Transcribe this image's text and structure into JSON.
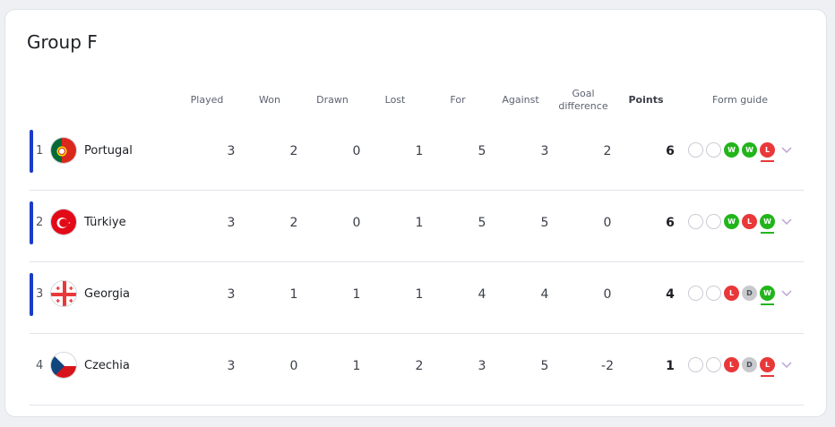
{
  "group_title": "Group F",
  "columns": {
    "played": "Played",
    "won": "Won",
    "drawn": "Drawn",
    "lost": "Lost",
    "for": "For",
    "against": "Against",
    "goal_difference": "Goal difference",
    "points": "Points",
    "form_guide": "Form guide"
  },
  "colors": {
    "qualifier": "#1a3cc7",
    "win": "#22b51b",
    "loss": "#e8383a",
    "draw": "#c8cace"
  },
  "rows": [
    {
      "pos": "1",
      "team": "Portugal",
      "flag": "portugal-flag-icon",
      "played": "3",
      "won": "2",
      "drawn": "0",
      "lost": "1",
      "for": "5",
      "against": "3",
      "gd": "2",
      "points": "6",
      "qualified": true,
      "form": [
        {
          "r": "E",
          "t": ""
        },
        {
          "r": "E",
          "t": ""
        },
        {
          "r": "W",
          "t": "W"
        },
        {
          "r": "W",
          "t": "W"
        },
        {
          "r": "L",
          "t": "L"
        }
      ]
    },
    {
      "pos": "2",
      "team": "Türkiye",
      "flag": "turkiye-flag-icon",
      "played": "3",
      "won": "2",
      "drawn": "0",
      "lost": "1",
      "for": "5",
      "against": "5",
      "gd": "0",
      "points": "6",
      "qualified": true,
      "form": [
        {
          "r": "E",
          "t": ""
        },
        {
          "r": "E",
          "t": ""
        },
        {
          "r": "W",
          "t": "W"
        },
        {
          "r": "L",
          "t": "L"
        },
        {
          "r": "W",
          "t": "W"
        }
      ]
    },
    {
      "pos": "3",
      "team": "Georgia",
      "flag": "georgia-flag-icon",
      "played": "3",
      "won": "1",
      "drawn": "1",
      "lost": "1",
      "for": "4",
      "against": "4",
      "gd": "0",
      "points": "4",
      "qualified": true,
      "form": [
        {
          "r": "E",
          "t": ""
        },
        {
          "r": "E",
          "t": ""
        },
        {
          "r": "L",
          "t": "L"
        },
        {
          "r": "D",
          "t": "D"
        },
        {
          "r": "W",
          "t": "W"
        }
      ]
    },
    {
      "pos": "4",
      "team": "Czechia",
      "flag": "czechia-flag-icon",
      "played": "3",
      "won": "0",
      "drawn": "1",
      "lost": "2",
      "for": "3",
      "against": "5",
      "gd": "-2",
      "points": "1",
      "qualified": false,
      "form": [
        {
          "r": "E",
          "t": ""
        },
        {
          "r": "E",
          "t": ""
        },
        {
          "r": "L",
          "t": "L"
        },
        {
          "r": "D",
          "t": "D"
        },
        {
          "r": "L",
          "t": "L"
        }
      ]
    }
  ]
}
